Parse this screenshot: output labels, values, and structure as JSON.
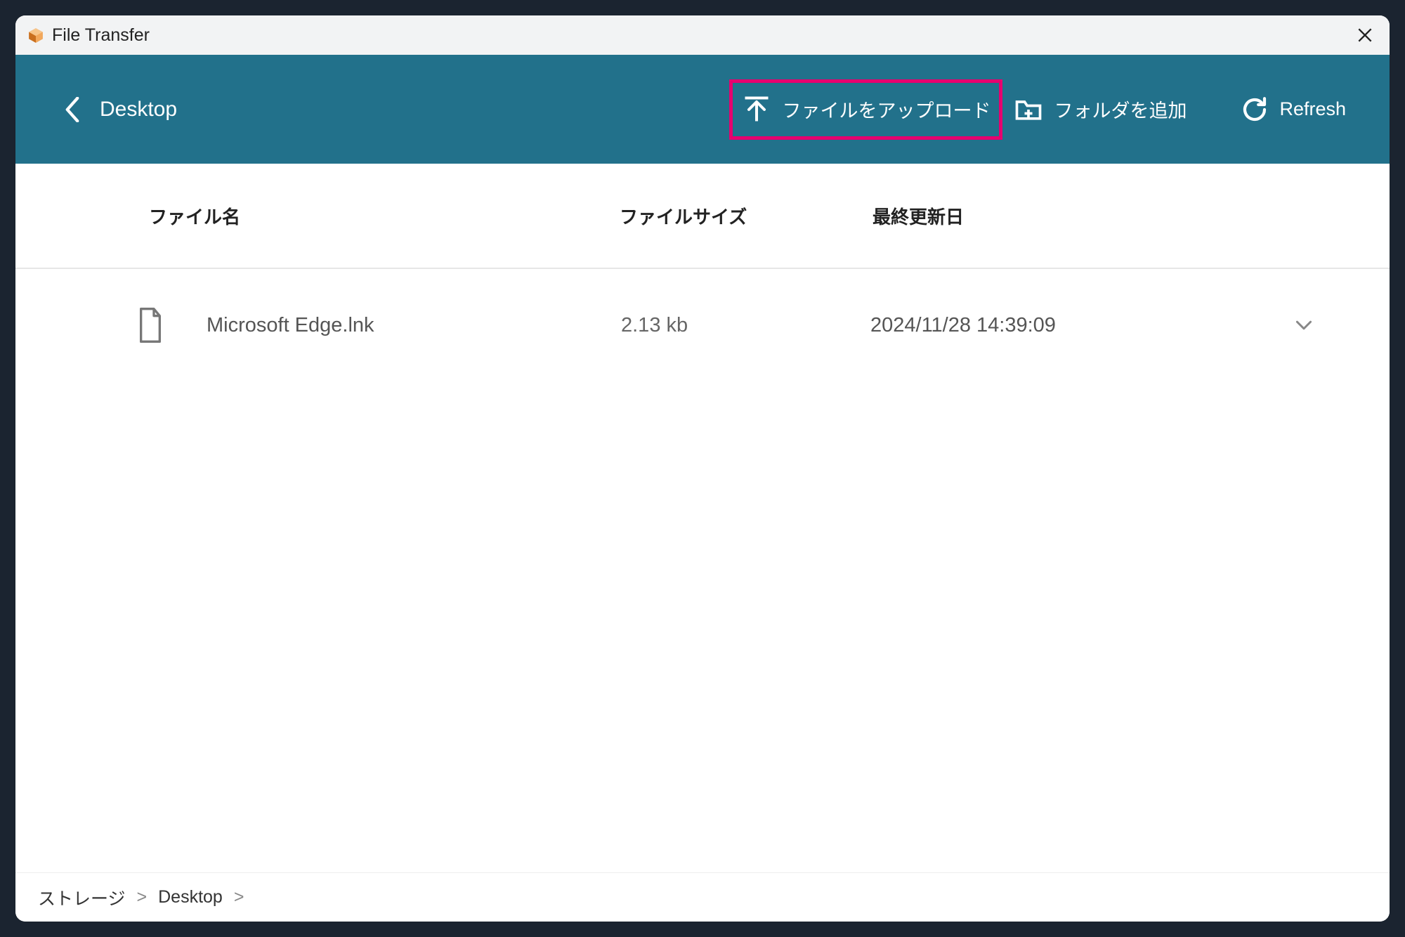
{
  "titlebar": {
    "title": "File Transfer"
  },
  "toolbar": {
    "location": "Desktop",
    "upload_label": "ファイルをアップロード",
    "add_folder_label": "フォルダを追加",
    "refresh_label": "Refresh"
  },
  "columns": {
    "name": "ファイル名",
    "size": "ファイルサイズ",
    "modified": "最終更新日"
  },
  "files": [
    {
      "name": "Microsoft Edge.lnk",
      "size": "2.13 kb",
      "modified": "2024/11/28 14:39:09"
    }
  ],
  "breadcrumb": {
    "root": "ストレージ",
    "path1": "Desktop",
    "sep": ">"
  }
}
